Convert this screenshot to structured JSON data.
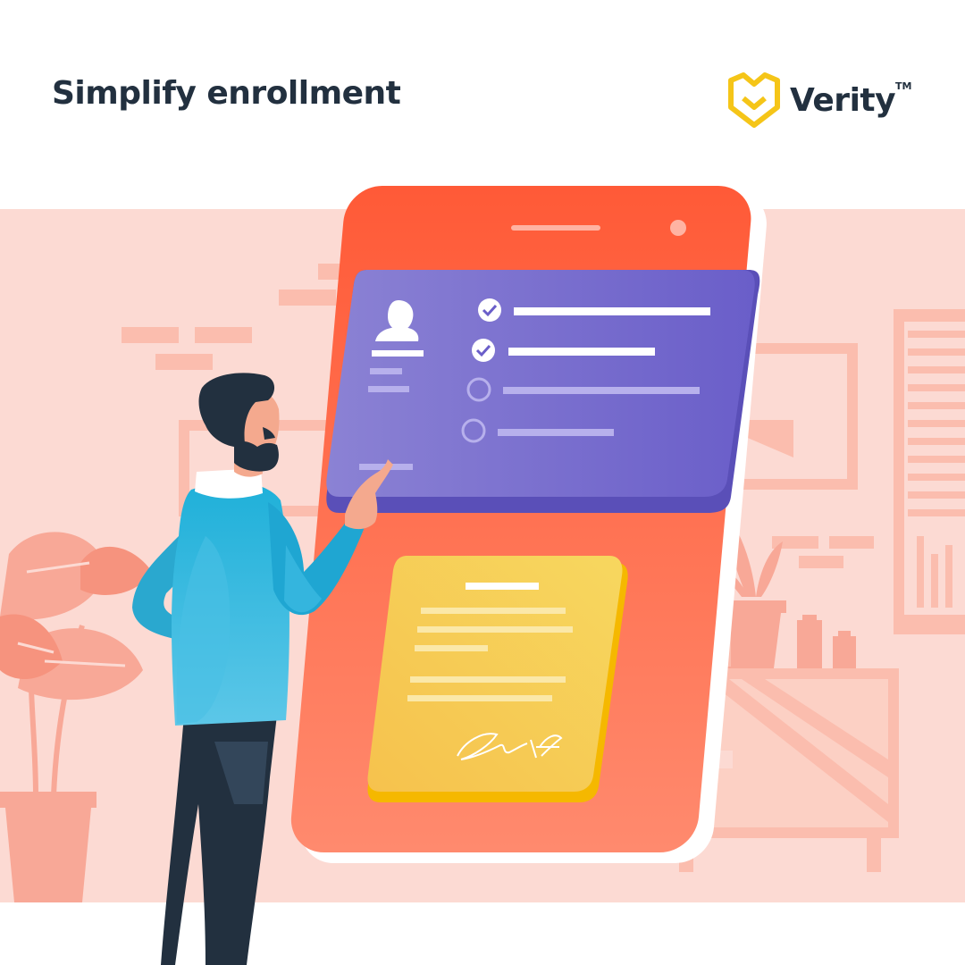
{
  "header": {
    "headline": "Simplify enrollment"
  },
  "logo": {
    "brand": "Verity",
    "trademark": "TM",
    "icon": "shield-chevron-icon",
    "accent_color": "#f5c518"
  },
  "illustration": {
    "background_color": "#fcd9d1",
    "decor_color": "#fbbdae",
    "phone_color": "#ff6b4a",
    "profile_card_color": "#7a6ed0",
    "document_color": "#f5c518",
    "checklist": [
      {
        "state": "checked"
      },
      {
        "state": "checked"
      },
      {
        "state": "unchecked"
      },
      {
        "state": "unchecked"
      }
    ],
    "person_shirt_color": "#38b6dc"
  }
}
